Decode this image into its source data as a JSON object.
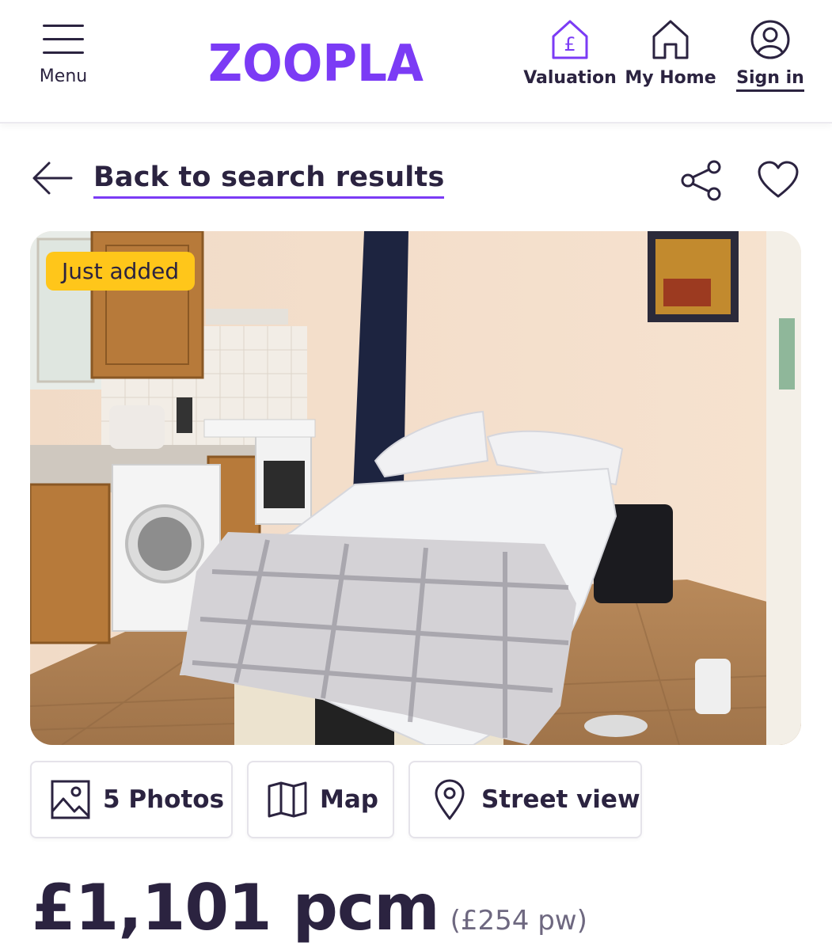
{
  "header": {
    "menu_label": "Menu",
    "logo_text": "ZOOPLA",
    "brand_color": "#7b3bf5",
    "nav": {
      "valuation_label": "Valuation",
      "my_home_label": "My Home",
      "sign_in_label": "Sign in"
    }
  },
  "back_link": "Back to search results",
  "listing": {
    "badge": "Just added",
    "media": {
      "photos_label": "5 Photos",
      "map_label": "Map",
      "street_view_label": "Street view"
    },
    "price": "£1,101 pcm",
    "price_weekly": "(£254 pw)"
  },
  "icons": [
    "menu-icon",
    "valuation-house-pound-icon",
    "home-icon",
    "user-icon",
    "arrow-left-icon",
    "share-icon",
    "heart-icon",
    "image-icon",
    "map-icon",
    "location-pin-icon"
  ]
}
